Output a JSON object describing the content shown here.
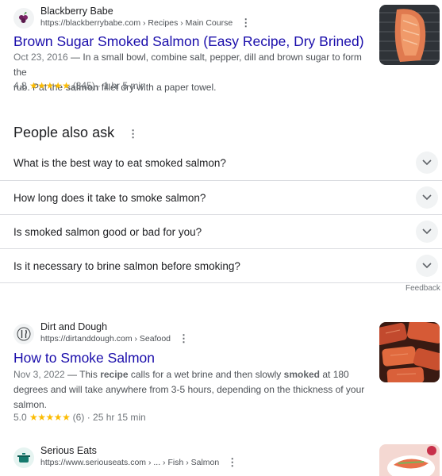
{
  "results": [
    {
      "site_name": "Blackberry Babe",
      "url": "https://blackberrybabe.com › Recipes › Main Course",
      "title": "Brown Sugar Smoked Salmon (Easy Recipe, Dry Brined)",
      "date": "Oct 23, 2016",
      "snippet_line1_prefix": " — In a small bowl, combine salt, pepper, dill and brown sugar to form the",
      "snippet_line2_a": "rub. Pat the ",
      "snippet_line2_bold": "salmon",
      "snippet_line2_b": " fillet dry with a paper towel.",
      "rating": "4.8",
      "stars": "★★★★★",
      "reviews": "(345)",
      "time": "· 1 hr 5 min"
    },
    {
      "site_name": "Dirt and Dough",
      "url": "https://dirtanddough.com › Seafood",
      "title": "How to Smoke Salmon",
      "date": "Nov 3, 2022",
      "l1_a": " — This ",
      "l1_b1": "recipe",
      "l1_c": " calls for a wet brine and then slowly ",
      "l1_b2": "smoked",
      "l1_d": " at 180",
      "line2": "degrees and will take anywhere from 3-5 hours, depending on the thickness of your",
      "line3": "salmon.",
      "rating": "5.0",
      "stars": "★★★★★",
      "reviews": "(6)",
      "time": "· 25 hr 15 min"
    },
    {
      "site_name": "Serious Eats",
      "url": "https://www.seriouseats.com › ... › Fish › Salmon"
    }
  ],
  "people_also_ask": {
    "heading": "People also ask",
    "questions": [
      "What is the best way to eat smoked salmon?",
      "How long does it take to smoke salmon?",
      "Is smoked salmon good or bad for you?",
      "Is it necessary to brine salmon before smoking?"
    ],
    "feedback": "Feedback"
  },
  "icons": {
    "kebab": "more-vert-icon",
    "chevron": "chevron-down-icon"
  },
  "colors": {
    "link": "#1a0dab",
    "star": "#fbbc04",
    "text": "#202124",
    "muted": "#4d5156"
  }
}
